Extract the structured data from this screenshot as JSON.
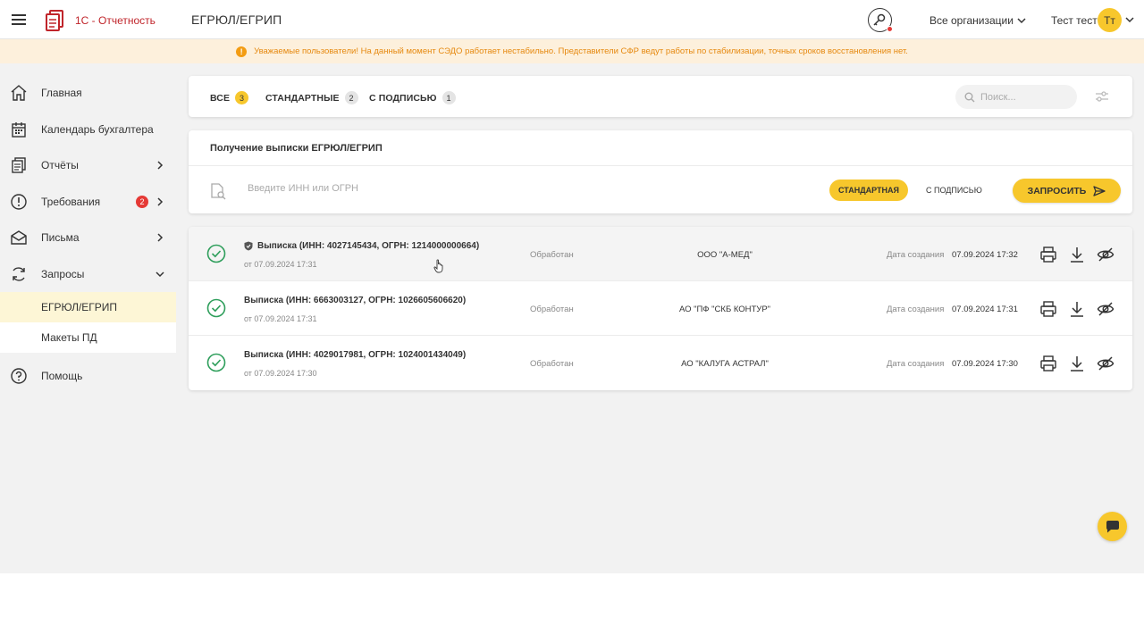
{
  "header": {
    "brand": "1С - Отчетность",
    "page_title": "ЕГРЮЛ/ЕГРИП",
    "org_select": "Все организации",
    "user_name": "Тест тест",
    "avatar_initials": "Тт"
  },
  "banner": {
    "text": "Уважаемые пользователи! На данный момент СЭДО работает нестабильно. Представители СФР ведут работы по стабилизации, точных сроков восстановления нет."
  },
  "sidebar": {
    "items": [
      {
        "label": "Главная",
        "icon": "home-icon"
      },
      {
        "label": "Календарь бухгалтера",
        "icon": "calendar-icon"
      },
      {
        "label": "Отчёты",
        "icon": "reports-icon"
      },
      {
        "label": "Требования",
        "icon": "alert-icon",
        "badge": "2"
      },
      {
        "label": "Письма",
        "icon": "mail-icon"
      },
      {
        "label": "Запросы",
        "icon": "refresh-icon"
      },
      {
        "label": "Помощь",
        "icon": "help-icon"
      }
    ],
    "subitems": [
      {
        "label": "ЕГРЮЛ/ЕГРИП",
        "active": true
      },
      {
        "label": "Макеты ПД"
      }
    ]
  },
  "tabs": [
    {
      "label": "ВСЕ",
      "count": "3"
    },
    {
      "label": "СТАНДАРТНЫЕ",
      "count": "2"
    },
    {
      "label": "С ПОДПИСЬЮ",
      "count": "1"
    }
  ],
  "search": {
    "placeholder": "Поиск..."
  },
  "request": {
    "title": "Получение выписки ЕГРЮЛ/ЕГРИП",
    "inn_placeholder": "Введите ИНН или ОГРН",
    "option_standard": "СТАНДАРТНАЯ",
    "option_signed": "С ПОДПИСЬЮ",
    "submit_label": "ЗАПРОСИТЬ"
  },
  "list": {
    "created_label": "Дата создания",
    "rows": [
      {
        "title": "Выписка (ИНН: 4027145434, ОГРН: 1214000000664)",
        "date": "от 07.09.2024 17:31",
        "status": "Обработан",
        "org": "ООО \"А-МЕД\"",
        "created": "07.09.2024 17:32",
        "signed": true
      },
      {
        "title": "Выписка (ИНН: 6663003127, ОГРН: 1026605606620)",
        "date": "от 07.09.2024 17:31",
        "status": "Обработан",
        "org": "АО \"ПФ \"СКБ КОНТУР\"",
        "created": "07.09.2024 17:31",
        "signed": false
      },
      {
        "title": "Выписка (ИНН: 4029017981, ОГРН: 1024001434049)",
        "date": "от 07.09.2024 17:30",
        "status": "Обработан",
        "org": "АО \"КАЛУГА АСТРАЛ\"",
        "created": "07.09.2024 17:30",
        "signed": false
      }
    ]
  },
  "colors": {
    "accent": "#f7c72c",
    "brand": "#c0252b",
    "success": "#2e9e5b",
    "warning": "#e6890f",
    "badge": "#e53935"
  }
}
